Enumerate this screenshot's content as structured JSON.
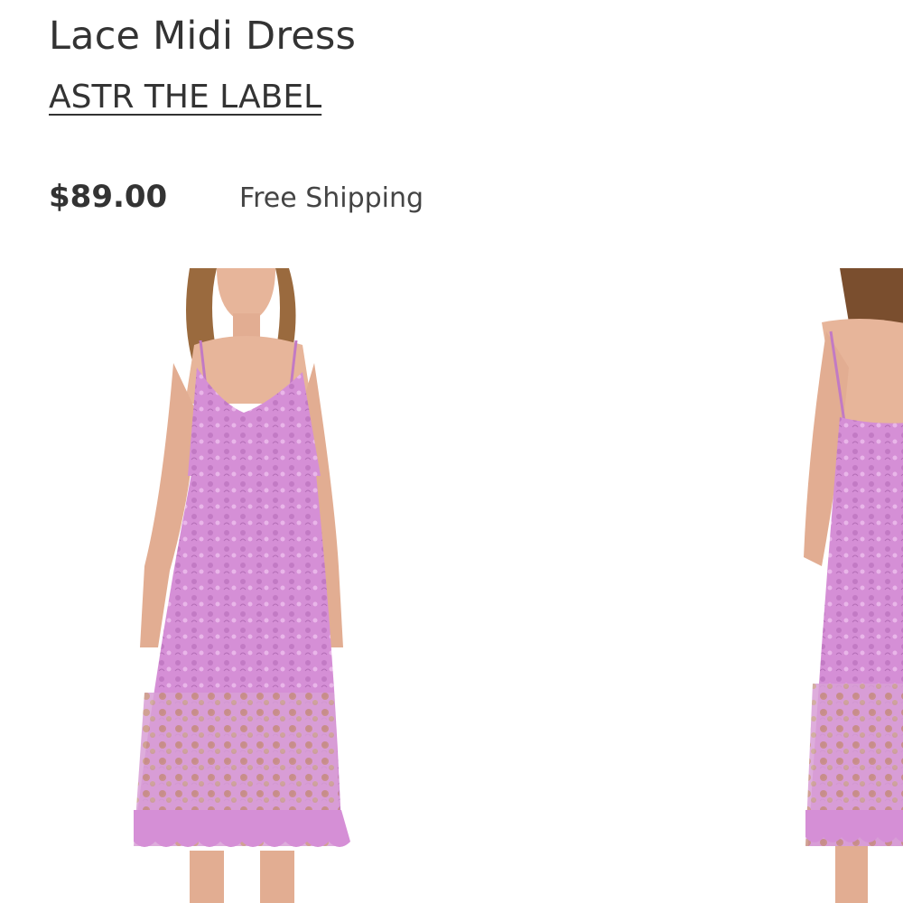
{
  "product": {
    "title": "Lace Midi Dress",
    "brand": "ASTR THE LABEL",
    "price": "$89.00",
    "shipping": "Free Shipping"
  },
  "colors": {
    "dress": "#d58fd6",
    "dress_shadow": "#b56fb8",
    "skin": "#e7b59a",
    "hair": "#8a5a34",
    "text": "#333333"
  },
  "gallery": {
    "images": [
      {
        "name": "front-view",
        "icon": "dress-front-photo"
      },
      {
        "name": "back-view",
        "icon": "dress-back-photo"
      }
    ]
  }
}
